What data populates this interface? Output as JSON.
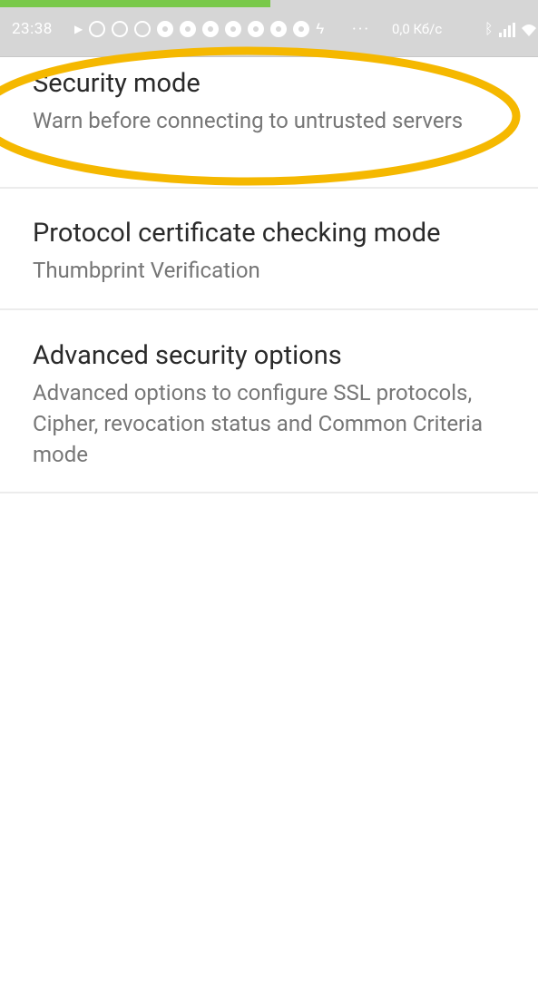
{
  "status_bar": {
    "time": "23:38",
    "speed": "0,0 Кб/с",
    "notification_icons": [
      "play-icon",
      "notification-icon",
      "notification-icon",
      "notification-icon",
      "app-icon",
      "app-icon",
      "app-icon",
      "app-icon",
      "app-icon",
      "app-icon",
      "app-icon",
      "bolt-icon"
    ]
  },
  "settings": {
    "security_mode": {
      "title": "Security mode",
      "summary": "Warn before connecting to untrusted servers"
    },
    "certificate_mode": {
      "title": "Protocol certificate checking mode",
      "summary": "Thumbprint Verification"
    },
    "advanced_security": {
      "title": "Advanced security options",
      "summary": "Advanced options to configure SSL protocols, Cipher, revocation status and Common Criteria mode"
    }
  },
  "colors": {
    "highlight": "#f5b800",
    "statusbar": "#d6d6d6",
    "title_text": "#2a2a2a",
    "summary_text": "#767676"
  }
}
